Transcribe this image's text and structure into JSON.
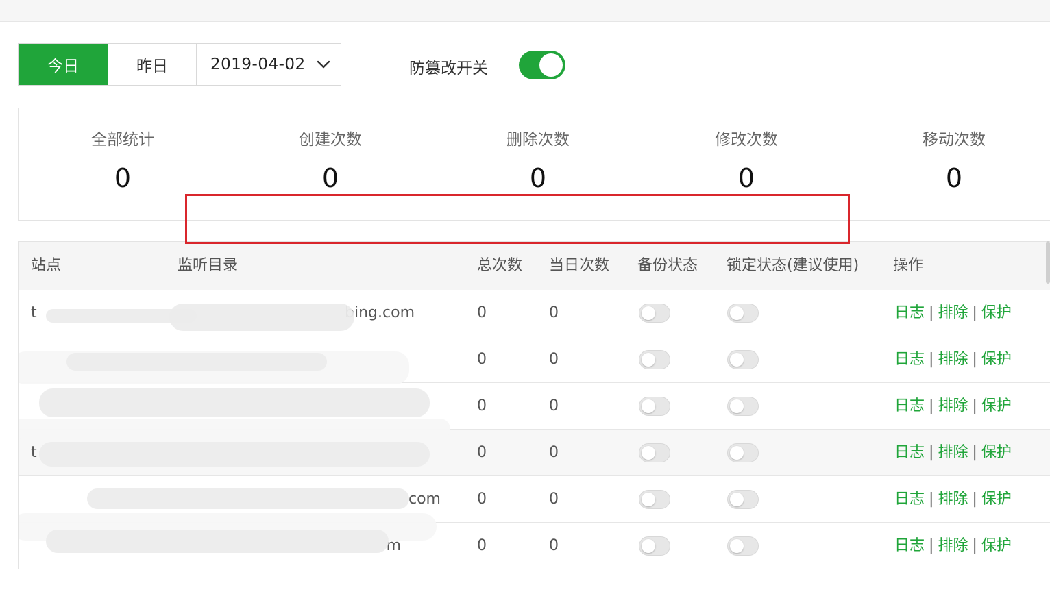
{
  "toolbar": {
    "today_label": "今日",
    "yesterday_label": "昨日",
    "date_value": "2019-04-02",
    "switch_label": "防篡改开关",
    "switch_on": true
  },
  "stats": [
    {
      "label": "全部统计",
      "value": "0"
    },
    {
      "label": "创建次数",
      "value": "0"
    },
    {
      "label": "删除次数",
      "value": "0"
    },
    {
      "label": "修改次数",
      "value": "0"
    },
    {
      "label": "移动次数",
      "value": "0"
    }
  ],
  "table": {
    "headers": [
      "站点",
      "监听目录",
      "总次数",
      "当日次数",
      "备份状态",
      "锁定状态(建议使用)",
      "操作"
    ],
    "rows": [
      {
        "site": "t",
        "dir": "bing.com",
        "total": "0",
        "today": "0",
        "backup": false,
        "lock": false
      },
      {
        "site": "",
        "dir": "",
        "total": "0",
        "today": "0",
        "backup": false,
        "lock": false
      },
      {
        "site": "",
        "dir": "",
        "total": "0",
        "today": "0",
        "backup": false,
        "lock": false
      },
      {
        "site": "t",
        "dir": "",
        "total": "0",
        "today": "0",
        "backup": false,
        "lock": false
      },
      {
        "site": "",
        "dir": "com",
        "total": "0",
        "today": "0",
        "backup": false,
        "lock": false
      },
      {
        "site": "",
        "dir": "m",
        "total": "0",
        "today": "0",
        "backup": false,
        "lock": false
      }
    ],
    "ops": {
      "log": "日志",
      "exclude": "排除",
      "protect": "保护",
      "separator": "|"
    }
  },
  "colors": {
    "accent": "#20a53a",
    "highlight": "#d9262c"
  }
}
